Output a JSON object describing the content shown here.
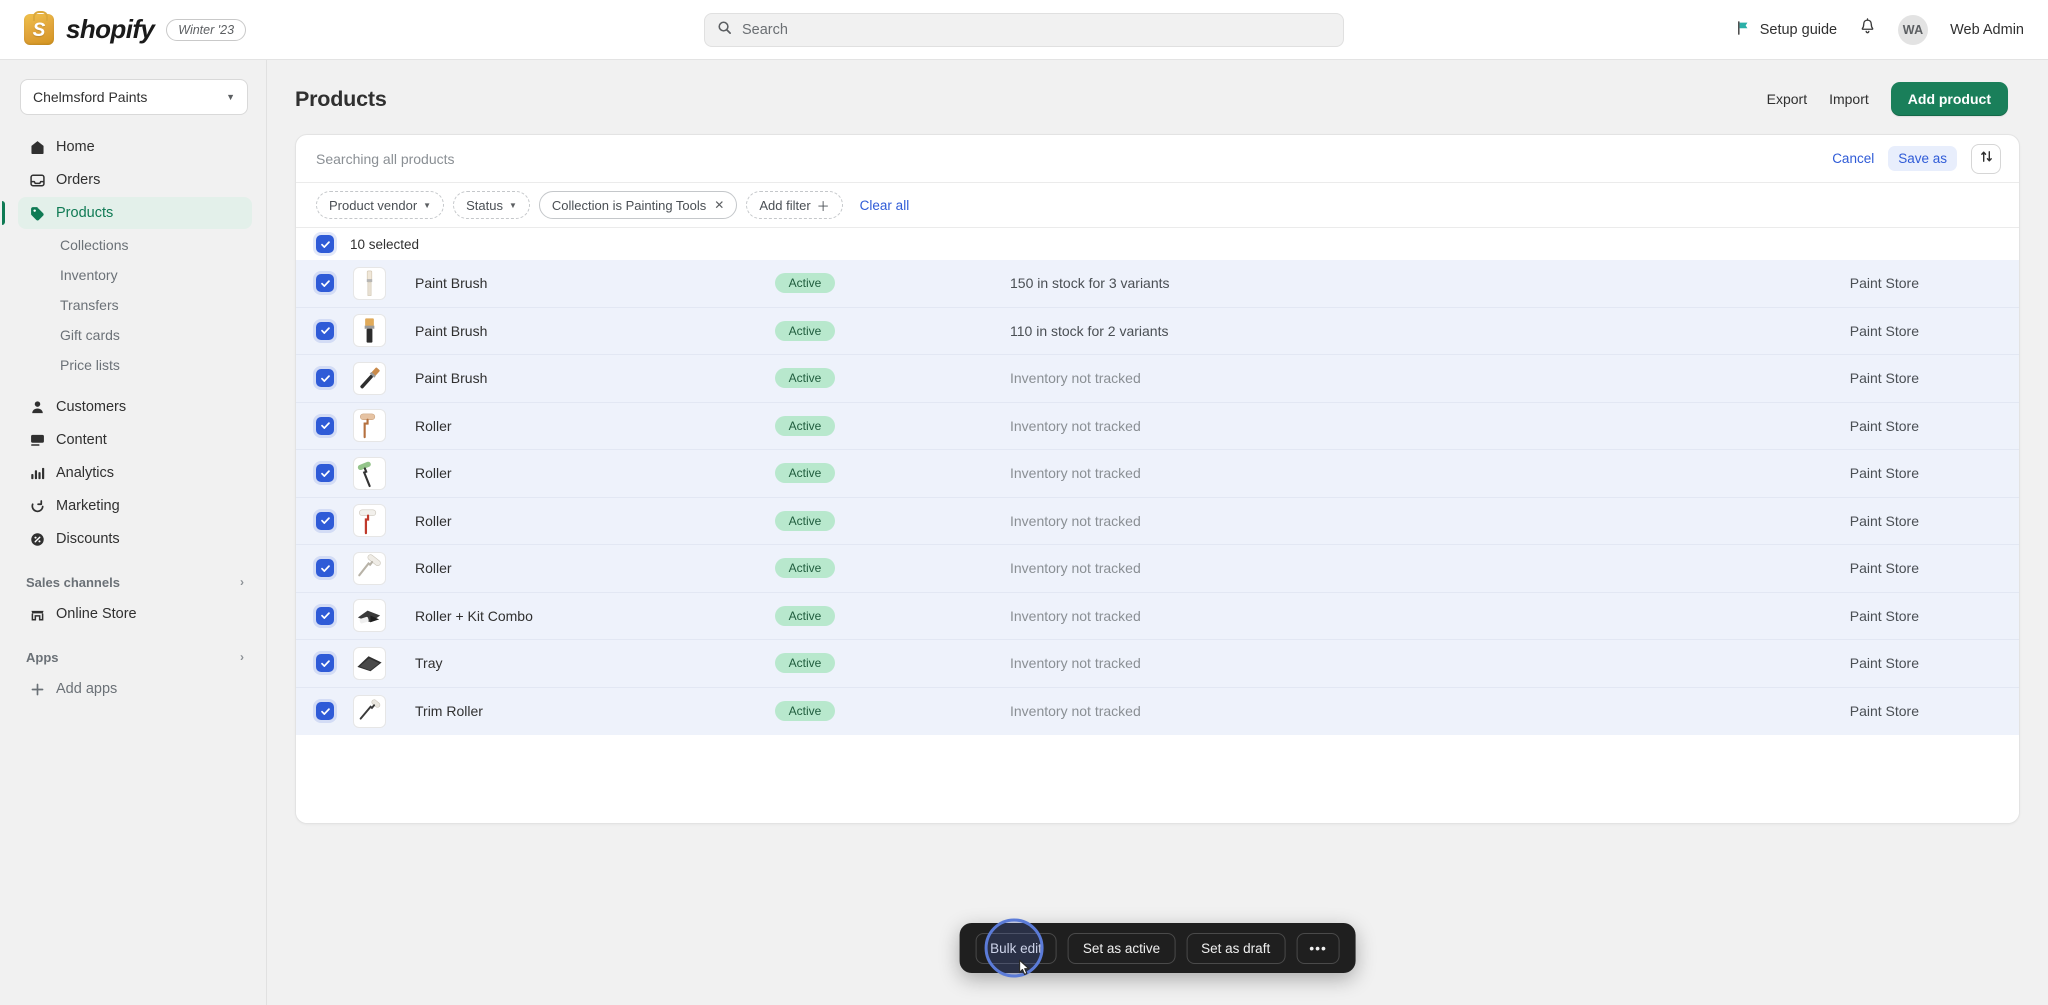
{
  "topbar": {
    "brand_name": "shopify",
    "brand_mark": "S",
    "season_badge": "Winter '23",
    "search_placeholder": "Search",
    "setup_guide": "Setup guide",
    "avatar_initials": "WA",
    "user_name": "Web Admin",
    "icons": [
      "search-icon",
      "flag-icon",
      "bell-icon"
    ]
  },
  "sidebar": {
    "store_name": "Chelmsford Paints",
    "items": [
      {
        "label": "Home",
        "icon": "home-icon",
        "active": false
      },
      {
        "label": "Orders",
        "icon": "orders-icon",
        "active": false
      },
      {
        "label": "Products",
        "icon": "products-tag-icon",
        "active": true
      }
    ],
    "product_subitems": [
      {
        "label": "Collections"
      },
      {
        "label": "Inventory"
      },
      {
        "label": "Transfers"
      },
      {
        "label": "Gift cards"
      },
      {
        "label": "Price lists"
      }
    ],
    "items2": [
      {
        "label": "Customers",
        "icon": "customers-icon"
      },
      {
        "label": "Content",
        "icon": "content-icon"
      },
      {
        "label": "Analytics",
        "icon": "analytics-icon"
      },
      {
        "label": "Marketing",
        "icon": "marketing-icon"
      },
      {
        "label": "Discounts",
        "icon": "discounts-icon"
      }
    ],
    "sales_channels_label": "Sales channels",
    "online_store_label": "Online Store",
    "apps_label": "Apps",
    "add_apps_label": "Add apps"
  },
  "page": {
    "title": "Products",
    "export_label": "Export",
    "import_label": "Import",
    "add_product_label": "Add product"
  },
  "toolbar": {
    "search_text": "Searching all products",
    "cancel_label": "Cancel",
    "save_as_label": "Save as",
    "sort_icon": "sort-arrows-icon"
  },
  "filters": [
    {
      "label": "Product vendor",
      "style": "dashed",
      "caret": true,
      "removable": false
    },
    {
      "label": "Status",
      "style": "dashed",
      "caret": true,
      "removable": false
    },
    {
      "label": "Collection is Painting Tools",
      "style": "solid",
      "caret": false,
      "removable": true
    },
    {
      "label": "Add filter",
      "style": "dashed",
      "caret": false,
      "plus": true,
      "removable": false
    }
  ],
  "clear_all_label": "Clear all",
  "selection": {
    "count_label": "10 selected"
  },
  "table": {
    "rows": [
      {
        "name": "Paint Brush",
        "thumb": "brush-white-icon",
        "status": "Active",
        "inventory": "150 in stock for 3 variants",
        "tracked": true,
        "vendor": "Paint Store"
      },
      {
        "name": "Paint Brush",
        "thumb": "brush-tan-icon",
        "status": "Active",
        "inventory": "110 in stock for 2 variants",
        "tracked": true,
        "vendor": "Paint Store"
      },
      {
        "name": "Paint Brush",
        "thumb": "brush-angled-icon",
        "status": "Active",
        "inventory": "Inventory not tracked",
        "tracked": false,
        "vendor": "Paint Store"
      },
      {
        "name": "Roller",
        "thumb": "roller-tan-icon",
        "status": "Active",
        "inventory": "Inventory not tracked",
        "tracked": false,
        "vendor": "Paint Store"
      },
      {
        "name": "Roller",
        "thumb": "roller-green-icon",
        "status": "Active",
        "inventory": "Inventory not tracked",
        "tracked": false,
        "vendor": "Paint Store"
      },
      {
        "name": "Roller",
        "thumb": "roller-red-icon",
        "status": "Active",
        "inventory": "Inventory not tracked",
        "tracked": false,
        "vendor": "Paint Store"
      },
      {
        "name": "Roller",
        "thumb": "roller-white-icon",
        "status": "Active",
        "inventory": "Inventory not tracked",
        "tracked": false,
        "vendor": "Paint Store"
      },
      {
        "name": "Roller + Kit Combo",
        "thumb": "roller-kit-icon",
        "status": "Active",
        "inventory": "Inventory not tracked",
        "tracked": false,
        "vendor": "Paint Store"
      },
      {
        "name": "Tray",
        "thumb": "tray-icon",
        "status": "Active",
        "inventory": "Inventory not tracked",
        "tracked": false,
        "vendor": "Paint Store"
      },
      {
        "name": "Trim Roller",
        "thumb": "trim-roller-icon",
        "status": "Active",
        "inventory": "Inventory not tracked",
        "tracked": false,
        "vendor": "Paint Store"
      }
    ]
  },
  "bulk_bar": {
    "buttons": [
      {
        "label": "Bulk edit",
        "hovered": true
      },
      {
        "label": "Set as active",
        "hovered": false
      },
      {
        "label": "Set as draft",
        "hovered": false
      },
      {
        "label": "•••",
        "hovered": false
      }
    ]
  },
  "colors": {
    "brand_green": "#1a7f5a",
    "nav_active_bg": "#e3f0ea",
    "nav_active_text": "#0f7a54",
    "link_blue": "#2f5bd7",
    "checkbox_blue": "#2f5bd7",
    "row_selected_bg": "#eef2fb",
    "badge_bg": "#b8e8cd",
    "badge_text": "#1f5c3d",
    "bulkbar_bg": "#1f1f1f",
    "cursor_ring": "#5b7bd8"
  }
}
